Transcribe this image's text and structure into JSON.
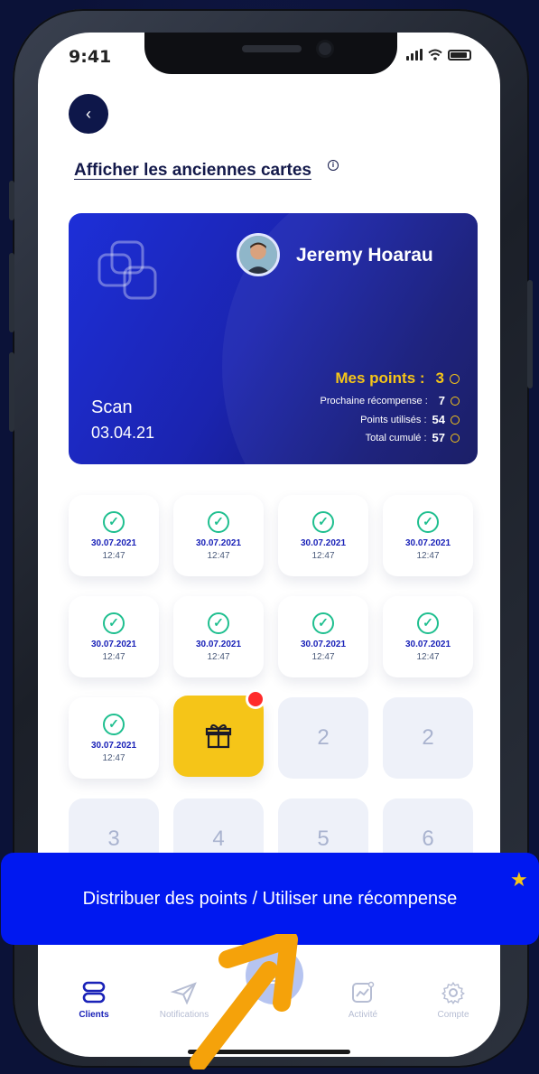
{
  "status_bar": {
    "time": "9:41"
  },
  "header": {
    "old_cards_link": "Afficher les anciennes cartes"
  },
  "card": {
    "holder_name": "Jeremy Hoarau",
    "scan_label": "Scan",
    "scan_date": "03.04.21",
    "points_label": "Mes points :",
    "points_value": "3",
    "next_reward_label": "Prochaine récompense :",
    "next_reward_value": "7",
    "used_label": "Points utilisés :",
    "used_value": "54",
    "total_label": "Total cumulé :",
    "total_value": "57"
  },
  "stamps": [
    {
      "date": "30.07.2021",
      "time": "12:47"
    },
    {
      "date": "30.07.2021",
      "time": "12:47"
    },
    {
      "date": "30.07.2021",
      "time": "12:47"
    },
    {
      "date": "30.07.2021",
      "time": "12:47"
    },
    {
      "date": "30.07.2021",
      "time": "12:47"
    },
    {
      "date": "30.07.2021",
      "time": "12:47"
    },
    {
      "date": "30.07.2021",
      "time": "12:47"
    },
    {
      "date": "30.07.2021",
      "time": "12:47"
    },
    {
      "date": "30.07.2021",
      "time": "12:47"
    }
  ],
  "empty_slots": [
    "2",
    "2",
    "3",
    "4",
    "5",
    "6"
  ],
  "banner": {
    "text": "Distribuer des points / Utiliser une récompense"
  },
  "tabs": {
    "clients": "Clients",
    "notifications": "Notifications",
    "activity": "Activité",
    "account": "Compte"
  },
  "colors": {
    "accent": "#1a22b8",
    "gold": "#f5c518",
    "banner": "#0018f0",
    "check": "#1fbf8f"
  }
}
